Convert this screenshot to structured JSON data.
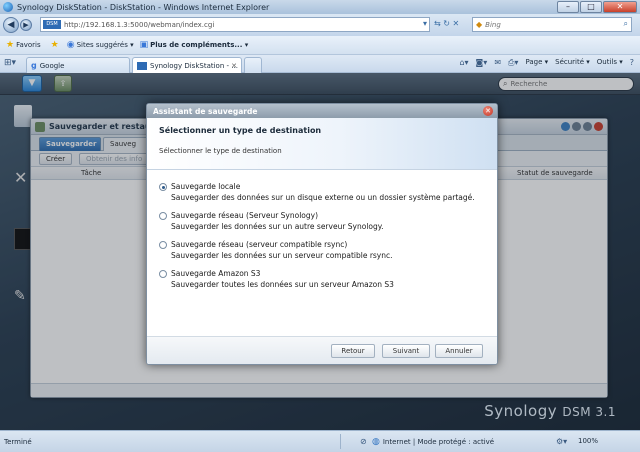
{
  "browser": {
    "window_title": "Synology DiskStation - DiskStation - Windows Internet Explorer",
    "address_url": "http://192.168.1.3:5000/webman/index.cgi",
    "site_badge": "DSM",
    "search_placeholder": "Bing",
    "favorites": {
      "favoris_label": "Favoris",
      "suggested_label": "Sites suggérés ▾",
      "more_addons_label": "Plus de compléments... ▾"
    },
    "tabs": [
      {
        "label": "Google"
      },
      {
        "label": "Synology DiskStation - ..."
      }
    ],
    "tools": {
      "page_label": "Page ▾",
      "security_label": "Sécurité ▾",
      "tools_label": "Outils ▾",
      "help_glyph": "?"
    },
    "status": {
      "left_text": "Terminé",
      "zone_text": "Internet | Mode protégé : activé",
      "zoom_text": "100%"
    }
  },
  "dsm": {
    "search_placeholder": "Recherche",
    "brand": "Synology",
    "brand_version": "DSM 3.1",
    "backup_app": {
      "title": "Sauvegarder et restaurer",
      "tabs": [
        "Sauvegarder",
        "Sauveg"
      ],
      "create_button": "Créer",
      "info_button": "Obtenir des info",
      "col_task": "Tâche",
      "col_status": "Statut de sauvegarde"
    }
  },
  "wizard": {
    "title": "Assistant de sauvegarde",
    "heading": "Sélectionner un type de destination",
    "subheading": "Sélectionner le type de destination",
    "options": [
      {
        "label": "Sauvegarde locale",
        "desc": "Sauvegarder des données sur un disque externe ou un dossier système partagé.",
        "checked": true
      },
      {
        "label": "Sauvegarde réseau (Serveur Synology)",
        "desc": "Sauvegarder les données sur un autre serveur Synology.",
        "checked": false
      },
      {
        "label": "Sauvegarde réseau (serveur compatible rsync)",
        "desc": "Sauvegarder les données sur un serveur compatible rsync.",
        "checked": false
      },
      {
        "label": "Sauvegarde Amazon S3",
        "desc": "Sauvegarder toutes les données sur un serveur Amazon S3",
        "checked": false
      }
    ],
    "buttons": {
      "back": "Retour",
      "next": "Suivant",
      "cancel": "Annuler"
    }
  },
  "colors": {
    "accent": "#2e6db0",
    "close": "#c23020",
    "desktop": "#2b3f52"
  }
}
